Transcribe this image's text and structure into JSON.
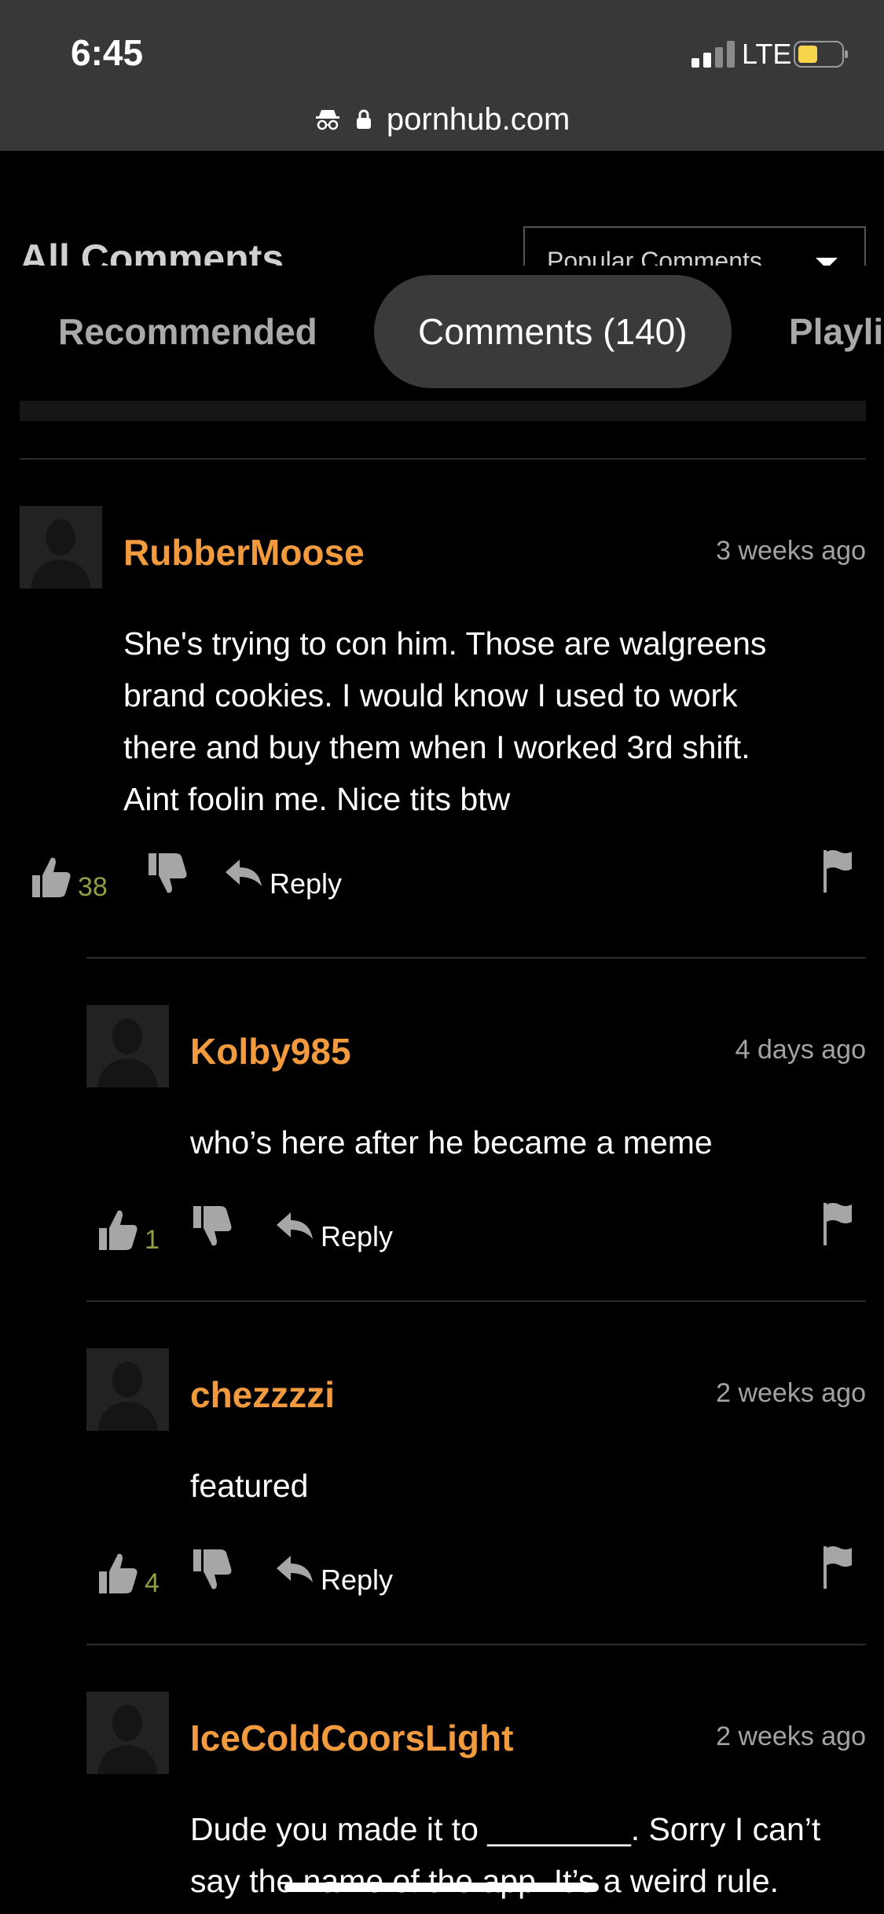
{
  "status_bar": {
    "time": "6:45",
    "network": "LTE"
  },
  "browser": {
    "url": "pornhub.com"
  },
  "page_header": {
    "title": "All Comments",
    "sort_selected": "Popular Comments"
  },
  "tabs": [
    {
      "label": "Recommended",
      "active": false
    },
    {
      "label": "Comments (140)",
      "active": true
    },
    {
      "label": "Playli",
      "active": false
    }
  ],
  "comments": [
    {
      "username": "RubberMoose",
      "timestamp": "3 weeks ago",
      "body_lines": [
        "She's trying to con him. Those are walgreens",
        "brand cookies. I would know I used to work",
        "there and buy them when I worked 3rd shift.",
        "Aint foolin me. Nice tits btw"
      ],
      "likes": "38",
      "reply_label": "Reply"
    },
    {
      "username": "Kolby985",
      "timestamp": "4 days ago",
      "body_lines": [
        "who’s here after he became a meme"
      ],
      "likes": "1",
      "reply_label": "Reply"
    },
    {
      "username": "chezzzzi",
      "timestamp": "2 weeks ago",
      "body_lines": [
        "featured"
      ],
      "likes": "4",
      "reply_label": "Reply"
    },
    {
      "username": "IceColdCoorsLight",
      "timestamp": "2 weeks ago",
      "body_lines": [
        "Dude you made it to ________. Sorry I can’t",
        "say the name of the app. It’s a weird rule."
      ]
    }
  ],
  "colors": {
    "username": "#f19a3e",
    "like_count": "#8da044",
    "tab_active_bg": "#3a3a3a",
    "status_bar_bg": "#38383b"
  },
  "icons": [
    "incognito-icon",
    "lock-icon",
    "signal-icon",
    "battery-icon",
    "thumbs-up-icon",
    "thumbs-down-icon",
    "reply-arrow-icon",
    "flag-icon",
    "default-avatar-icon"
  ]
}
